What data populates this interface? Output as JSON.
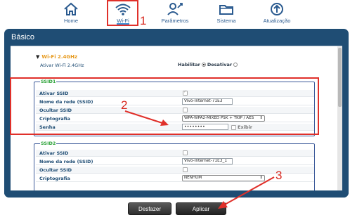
{
  "nav": {
    "items": [
      {
        "label": "Home",
        "icon": "home-icon"
      },
      {
        "label": "Wi-Fi",
        "icon": "wifi-icon"
      },
      {
        "label": "Parâmetros",
        "icon": "parameters-icon"
      },
      {
        "label": "Sistema",
        "icon": "system-icon"
      },
      {
        "label": "Atualização",
        "icon": "update-icon"
      }
    ]
  },
  "annotations": {
    "one": "1",
    "two": "2",
    "three": "3"
  },
  "panel": {
    "title": "Básico",
    "band_title": "Wi-Fi 2.4GHz",
    "activate_label": "Ativar Wi-Fi 2.4GHz",
    "enable_label": "Habilitar",
    "disable_label": "Desativar",
    "enabled": true
  },
  "ssid1": {
    "legend": "SSID1",
    "activate_label": "Ativar SSID",
    "activate_checked": true,
    "name_label": "Nome da rede (SSID)",
    "name_value": "Vivo-Internet-71E3",
    "hide_label": "Ocultar SSID",
    "hide_checked": false,
    "crypto_label": "Criptografia",
    "crypto_value": "WPA-WPA2-MIXED PSK + TKIP / AES",
    "password_label": "Senha",
    "password_value": "••••••••",
    "show_label": "Exibir"
  },
  "ssid2": {
    "legend": "SSID2",
    "activate_label": "Ativar SSID",
    "activate_checked": false,
    "name_label": "Nome da rede (SSID)",
    "name_value": "Vivo-Internet-71E3_1",
    "hide_label": "Ocultar SSID",
    "hide_checked": false,
    "crypto_label": "Criptografia",
    "crypto_value": "NENHUM"
  },
  "buttons": {
    "undo": "Desfazer",
    "apply": "Aplicar"
  },
  "colors": {
    "accent": "#1f4d74",
    "highlight": "#e0302a",
    "band": "#e79a1e",
    "legend": "#2ea33a"
  }
}
